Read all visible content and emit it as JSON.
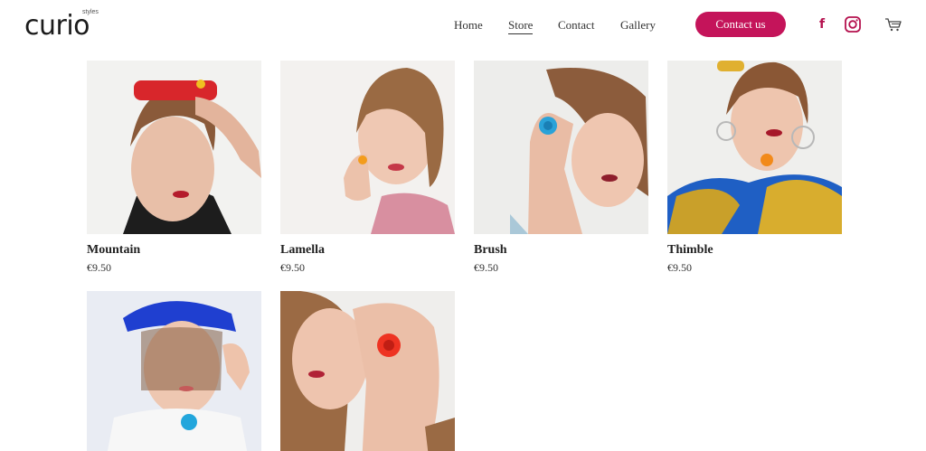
{
  "brand": {
    "name": "curio",
    "tagline": "styles"
  },
  "nav": {
    "items": [
      {
        "label": "Home"
      },
      {
        "label": "Store"
      },
      {
        "label": "Contact"
      },
      {
        "label": "Gallery"
      }
    ],
    "active": "Store",
    "cta_label": "Contact us"
  },
  "header_icons": [
    "facebook-icon",
    "instagram-icon",
    "cart-icon"
  ],
  "colors": {
    "accent": "#c4145a",
    "text": "#222222",
    "background": "#ffffff"
  },
  "products": [
    {
      "name": "Mountain",
      "price": "€9.50"
    },
    {
      "name": "Lamella",
      "price": "€9.50"
    },
    {
      "name": "Brush",
      "price": "€9.50"
    },
    {
      "name": "Thimble",
      "price": "€9.50"
    },
    {
      "name": "",
      "price": ""
    },
    {
      "name": "",
      "price": ""
    }
  ]
}
